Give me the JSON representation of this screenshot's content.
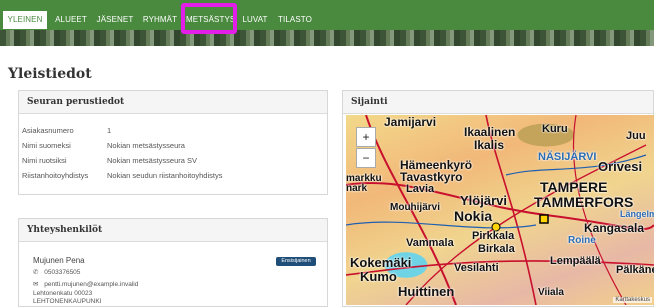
{
  "nav": {
    "tabs": [
      {
        "label": "YLEINEN"
      },
      {
        "label": "ALUEET"
      },
      {
        "label": "JÄSENET"
      },
      {
        "label": "RYHMÄT"
      },
      {
        "label": "METSÄSTYS"
      },
      {
        "label": "LUVAT"
      },
      {
        "label": "TILASTO"
      }
    ],
    "active_tab": "YLEINEN",
    "highlighted_tab": "METSÄSTYS",
    "accent_color": "#4a8a3f",
    "highlight_color": "#e31ee8"
  },
  "page": {
    "title": "Yleistiedot"
  },
  "basic_info": {
    "heading": "Seuran perustiedot",
    "rows": [
      {
        "label": "Asiakasnumero",
        "value": "1"
      },
      {
        "label": "Nimi suomeksi",
        "value": "Nokian metsästysseura"
      },
      {
        "label": "Nimi ruotsiksi",
        "value": "Nokian metsästysseura SV"
      },
      {
        "label": "Riistanhoitoyhdistys",
        "value": "Nokian seudun riistanhoitoyhdistys"
      }
    ]
  },
  "location": {
    "heading": "Sijainti",
    "zoom_in": "+",
    "zoom_out": "−",
    "places": [
      "Jamijarvi",
      "Ikaalinen",
      "Ikalis",
      "Kuru",
      "Juu",
      "NÄSIJÄRVI",
      "Orivesi",
      "Hämeenkyrö",
      "Tavastkyro",
      "markku",
      "nark",
      "Lavia",
      "TAMPERE",
      "TAMMERFORS",
      "Mouhijärvi",
      "Ylöjärvi",
      "Nokia",
      "Kangasala",
      "Längelmä",
      "Vammala",
      "Pirkkala",
      "Birkala",
      "Roine",
      "Kokemäki",
      "Kumo",
      "Vesilahti",
      "Lempäälä",
      "Pälkäne",
      "Huittinen",
      "Viiala"
    ],
    "attribution": "Karttakeskus"
  },
  "contacts": {
    "heading": "Yhteyshenkilöt",
    "name": "Mujunen Pena",
    "badge": "Ensisijainen",
    "phone": "0503376505",
    "email": "pentti.mujunen@example.invalid",
    "address_line1": "Lehtonenkatu 00023",
    "address_line2": "LEHTONENKAUPUNKI",
    "icons": {
      "phone": "phone-icon",
      "email": "envelope-icon"
    }
  }
}
